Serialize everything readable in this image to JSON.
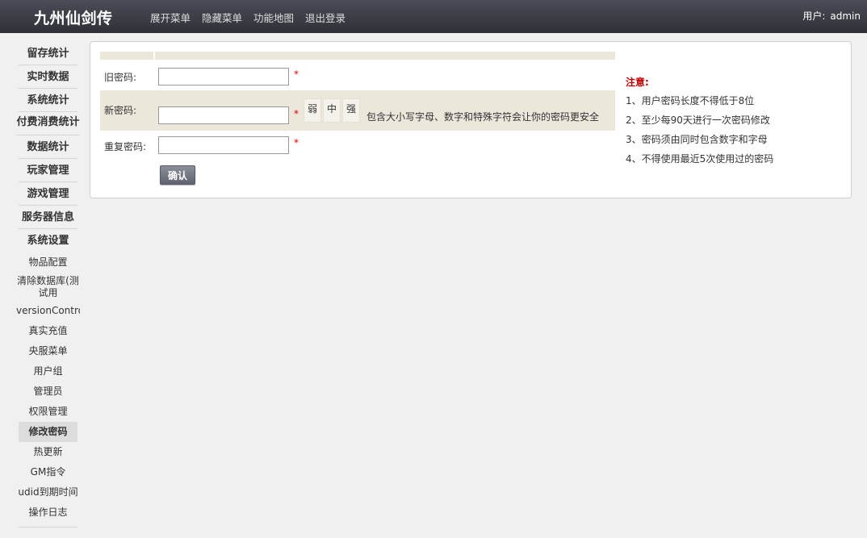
{
  "header": {
    "logo": "九州仙剑传",
    "nav": [
      "展开菜单",
      "隐藏菜单",
      "功能地图",
      "退出登录"
    ],
    "user_label": "用户:",
    "user_name": "admin"
  },
  "sidebar": {
    "sections": [
      "留存统计",
      "实时数据",
      "系统统计",
      "付费消费统计",
      "数据统计",
      "玩家管理",
      "游戏管理",
      "服务器信息",
      "系统设置"
    ],
    "items": [
      "物品配置",
      "清除数据库(测试用",
      "versionContro",
      "真实充值",
      "央服菜单",
      "用户组",
      "管理员",
      "权限管理",
      "修改密码",
      "热更新",
      "GM指令",
      "udid到期时间",
      "操作日志"
    ],
    "active_item": "修改密码"
  },
  "form": {
    "old_password_label": "旧密码:",
    "new_password_label": "新密码:",
    "repeat_password_label": "重复密码:",
    "old_password_value": "",
    "new_password_value": "",
    "repeat_password_value": "",
    "required_mark": "*",
    "strength_levels": [
      "弱",
      "中",
      "强"
    ],
    "strength_tip": "包含大小写字母、数字和特殊字符会让你的密码更安全",
    "submit_label": "确认"
  },
  "notes": {
    "title": "注意:",
    "items": [
      "1、用户密码长度不得低于8位",
      "2、至少每90天进行一次密码修改",
      "3、密码须由同时包含数字和字母",
      "4、不得使用最近5次使用过的密码"
    ]
  }
}
